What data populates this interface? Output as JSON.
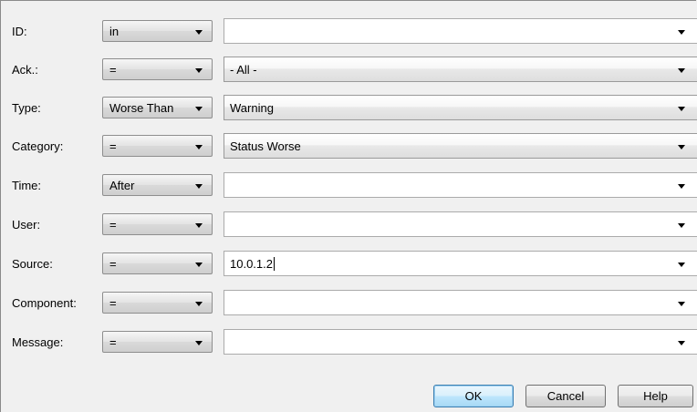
{
  "filters": [
    {
      "label": "ID:",
      "operator": "in",
      "value": "",
      "value_style": "plain"
    },
    {
      "label": "Ack.:",
      "operator": "=",
      "value": "- All -",
      "value_style": "gradient"
    },
    {
      "label": "Type:",
      "operator": "Worse Than",
      "value": "Warning",
      "value_style": "gradient"
    },
    {
      "label": "Category:",
      "operator": "=",
      "value": "Status Worse",
      "value_style": "gradient"
    },
    {
      "label": "Time:",
      "operator": "After",
      "value": "",
      "value_style": "plain"
    },
    {
      "label": "User:",
      "operator": "=",
      "value": "",
      "value_style": "plain"
    },
    {
      "label": "Source:",
      "operator": "=",
      "value": "10.0.1.2",
      "value_style": "plain"
    },
    {
      "label": "Component:",
      "operator": "=",
      "value": "",
      "value_style": "plain"
    },
    {
      "label": "Message:",
      "operator": "=",
      "value": "",
      "value_style": "plain"
    }
  ],
  "buttons": {
    "ok": "OK",
    "cancel": "Cancel",
    "help": "Help"
  },
  "icons": {
    "dropdown": "chevron-down-icon"
  },
  "colors": {
    "background": "#f0f0f0",
    "default_button_border": "#3c7fb1"
  }
}
